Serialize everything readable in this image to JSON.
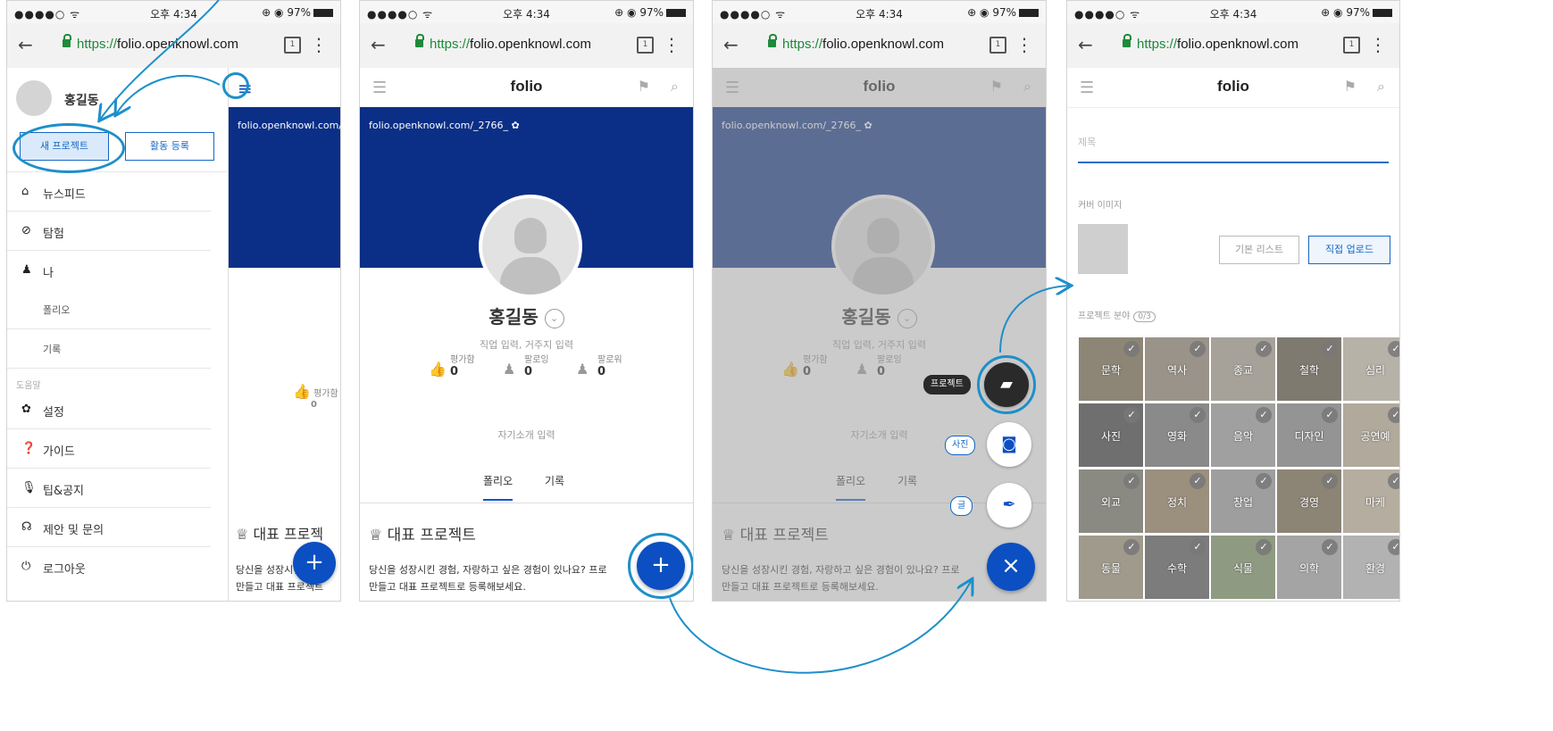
{
  "status": {
    "signal": "●●●●○ ᯤ",
    "time": "오후 4:34",
    "battery": "⊕ ◉ 97%"
  },
  "browser": {
    "scheme": "https://",
    "host": "folio.openknowl.com",
    "tab_count": "1"
  },
  "app": {
    "logo": "folio"
  },
  "profile": {
    "banner_url": "folio.openknowl.com/_2766_",
    "banner_url_short": "folio.openknowl.com/_",
    "name": "홍길동",
    "sub": "직업 입력, 거주지 입력",
    "stats": [
      {
        "label": "평가함",
        "value": "0"
      },
      {
        "label": "팔로잉",
        "value": "0"
      },
      {
        "label": "팔로워",
        "value": "0"
      }
    ],
    "stat_short_label": "평가함",
    "intro": "자기소개 입력",
    "tabs": [
      "폴리오",
      "기록"
    ],
    "featured_title": "대표 프로젝트",
    "featured_desc_line1": "당신을 성장시킨 경험, 자랑하고 싶은 경험이 있나요? 프로",
    "featured_desc_line2": "만들고 대표 프로젝트로 등록해보세요.",
    "featured_title_short": "대표 프로젝",
    "featured_desc_short1": "당신을 성장시킨 경험,",
    "featured_desc_short2": "만들고 대표 프로젝트"
  },
  "drawer": {
    "user": "홍길동",
    "new_project": "새 프로젝트",
    "register_activity": "활동 등록",
    "items": [
      "뉴스피드",
      "탐험",
      "나"
    ],
    "sub_items": [
      "폴리오",
      "기록"
    ],
    "help_section": "도움말",
    "help_items": [
      "설정",
      "가이드",
      "팁&공지",
      "제안 및 문의",
      "로그아웃"
    ]
  },
  "fab_menu": {
    "project": "프로젝트",
    "photo": "사진",
    "text": "글"
  },
  "form": {
    "title_placeholder": "제목",
    "cover_label": "커버 이미지",
    "default_list": "기본 리스트",
    "direct_upload": "직접 업로드",
    "category_label": "프로젝트 분야",
    "category_count": "0/3",
    "categories": [
      "문학",
      "역사",
      "종교",
      "철학",
      "심리",
      "사진",
      "영화",
      "음악",
      "디자인",
      "공연예",
      "외교",
      "정치",
      "창업",
      "경영",
      "마케",
      "동물",
      "수학",
      "식물",
      "의학",
      "환경"
    ]
  },
  "colors": {
    "brand": "#0b2f86",
    "fab": "#0b4fc2",
    "annotation": "#1e8fca"
  }
}
